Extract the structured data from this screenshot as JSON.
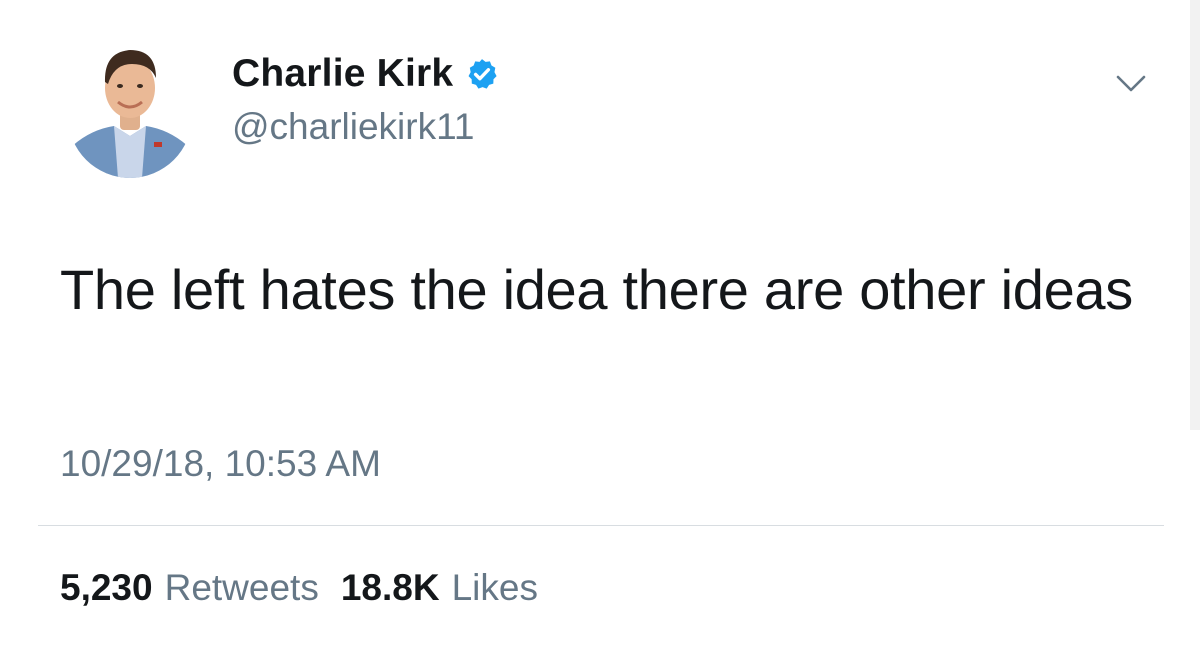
{
  "author": {
    "display_name": "Charlie Kirk",
    "handle": "@charliekirk11",
    "verified": true,
    "avatar_icon": "profile-photo"
  },
  "tweet": {
    "text": "The left hates the idea there are other ideas",
    "timestamp": "10/29/18, 10:53 AM"
  },
  "stats": {
    "retweets_count": "5,230",
    "retweets_label": "Retweets",
    "likes_count": "18.8K",
    "likes_label": "Likes"
  },
  "colors": {
    "text_primary": "#14171a",
    "text_secondary": "#657786",
    "verified_blue": "#1da1f2",
    "divider": "#d8dde1"
  },
  "icons": {
    "menu": "chevron-down-icon",
    "verified": "verified-badge-icon"
  }
}
